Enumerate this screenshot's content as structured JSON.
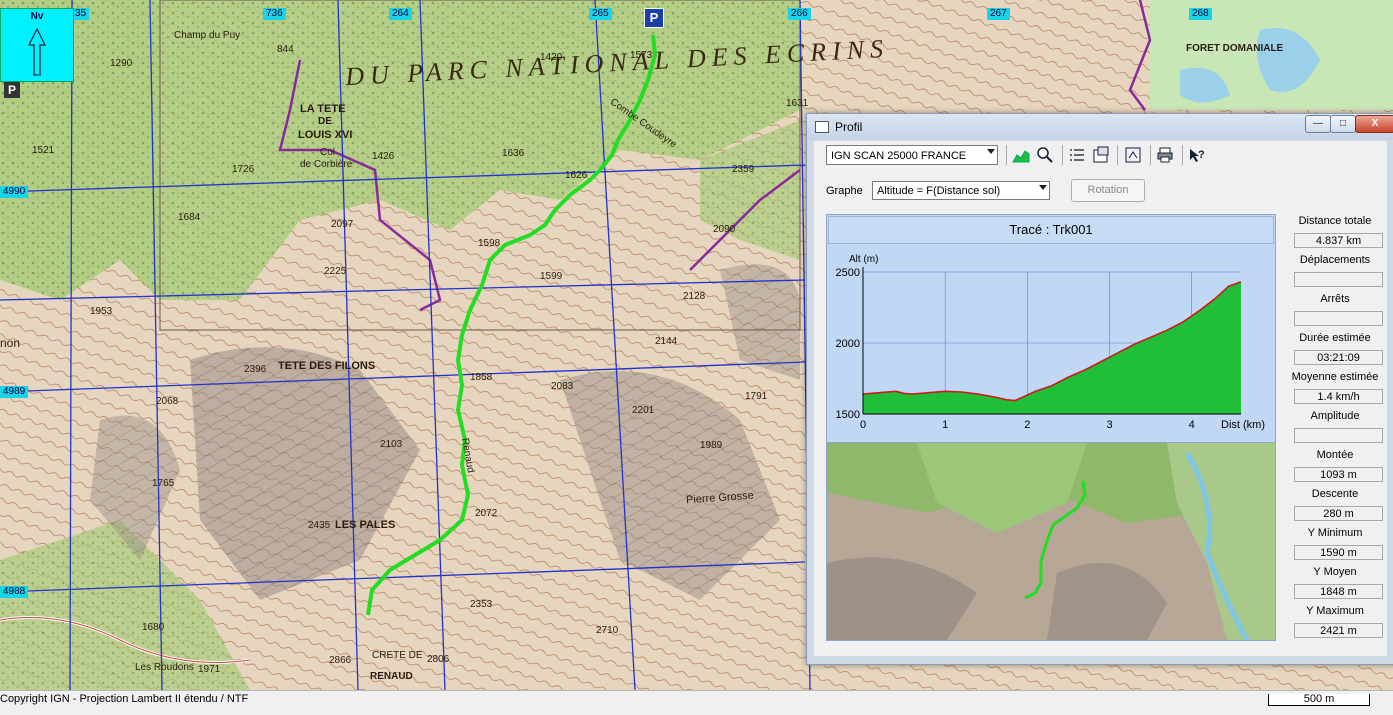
{
  "map": {
    "grid_labels_top": [
      "35",
      "736",
      "264",
      "265",
      "266",
      "267",
      "268"
    ],
    "grid_labels_left": [
      "4990",
      "4989",
      "4988"
    ],
    "north_label": "Nv",
    "parking_label": "P",
    "park_title": "DU   PARC   NATIONAL   DES   ECRINS",
    "place_names": [
      "LA TETE",
      "DE",
      "LOUIS XVI",
      "Col",
      "de Corbière",
      "TETE DES FILONS",
      "LES PALES",
      "Pierre Grosse",
      "CRETE DE",
      "RENAUD",
      "FORET DOMANIALE",
      "Champ du Puy",
      "Combe Coudeyre",
      "Renaud",
      "Les Roudons",
      "non"
    ],
    "spot_heights": [
      "844",
      "1290",
      "1521",
      "1426",
      "1636",
      "1626",
      "1598",
      "1599",
      "2097",
      "2225",
      "1953",
      "1684",
      "1726",
      "2396",
      "2068",
      "2103",
      "1765",
      "2435",
      "2083",
      "2201",
      "1989",
      "2072",
      "2353",
      "2710",
      "2806",
      "2090",
      "2128",
      "2144",
      "1791",
      "2359",
      "1631",
      "1573",
      "1420",
      "1680",
      "1971",
      "2866",
      "1858"
    ],
    "copyright": "Copyright IGN - Projection Lambert II étendu / NTF",
    "scale": "500 m"
  },
  "dialog": {
    "title": "Profil",
    "window_buttons": {
      "minimize": "—",
      "maximize": "□",
      "close": "X"
    },
    "map_source": "IGN SCAN 25000 FRANCE",
    "toolbar_icons": [
      "profile-icon",
      "zoom-icon",
      "list-icon",
      "properties-icon",
      "export-icon",
      "print-icon",
      "help-icon"
    ],
    "graph_label": "Graphe",
    "graph_mode": "Altitude = F(Distance sol)",
    "rotation_button": "Rotation",
    "trace_title": "Tracé : Trk001",
    "stats": [
      {
        "label": "Distance totale",
        "value": "4.837 km"
      },
      {
        "label": "Déplacements",
        "value": ""
      },
      {
        "label": "Arrêts",
        "value": ""
      },
      {
        "label": "Durée estimée",
        "value": "03:21:09"
      },
      {
        "label": "Moyenne estimée",
        "value": "1.4 km/h"
      },
      {
        "label": "Amplitude",
        "value": ""
      },
      {
        "label": "Montée",
        "value": "1093 m"
      },
      {
        "label": "Descente",
        "value": "280 m"
      },
      {
        "label": "Y Minimum",
        "value": "1590 m"
      },
      {
        "label": "Y Moyen",
        "value": "1848 m"
      },
      {
        "label": "Y Maximum",
        "value": "2421 m"
      }
    ]
  },
  "colors": {
    "fill": "#1fbf3a",
    "line": "#cc1a1a",
    "track": "#22dd22",
    "chart_bg": "#c1d8f5",
    "grid": "#2233cc"
  },
  "chart_data": {
    "type": "area",
    "ylabel": "Alt (m)",
    "xlabel": "Dist (km)",
    "xticks": [
      "0",
      "1",
      "2",
      "3",
      "4"
    ],
    "yticks": [
      "1500",
      "2000",
      "2500"
    ],
    "xlim": [
      0,
      4.6
    ],
    "ylim": [
      1500,
      2500
    ],
    "x": [
      0,
      0.2,
      0.4,
      0.5,
      0.6,
      0.8,
      1.0,
      1.2,
      1.4,
      1.6,
      1.75,
      1.85,
      1.95,
      2.1,
      2.3,
      2.5,
      2.7,
      2.9,
      3.1,
      3.3,
      3.5,
      3.7,
      3.9,
      4.1,
      4.3,
      4.45,
      4.6
    ],
    "values": [
      1640,
      1650,
      1660,
      1645,
      1640,
      1650,
      1660,
      1655,
      1640,
      1620,
      1600,
      1595,
      1620,
      1660,
      1700,
      1760,
      1810,
      1870,
      1930,
      1990,
      2040,
      2090,
      2150,
      2230,
      2320,
      2400,
      2430
    ]
  }
}
